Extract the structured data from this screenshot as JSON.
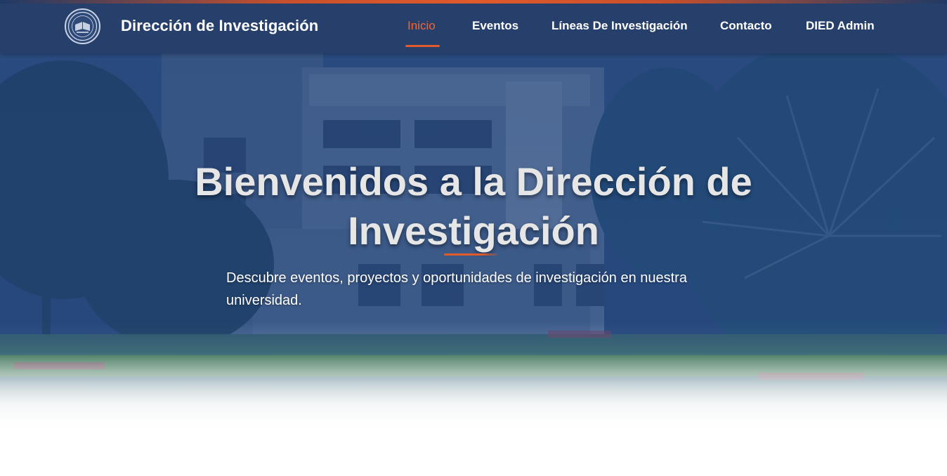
{
  "header": {
    "brand": "Dirección de Investigación",
    "logo_icon": "university-seal-icon",
    "nav": [
      {
        "label": "Inicio",
        "active": true
      },
      {
        "label": "Eventos",
        "active": false
      },
      {
        "label": "Líneas De Investigación",
        "active": false
      },
      {
        "label": "Contacto",
        "active": false
      },
      {
        "label": "DIED Admin",
        "active": false
      }
    ]
  },
  "hero": {
    "title": "Bienvenidos a la Dirección de Investigación",
    "subtitle": "Descubre eventos, proyectos y oportunidades de investigación en nuestra universidad."
  },
  "colors": {
    "header_bg": "#27406b",
    "accent": "#e05a2b",
    "hero_overlay": "#1b3a6e"
  }
}
